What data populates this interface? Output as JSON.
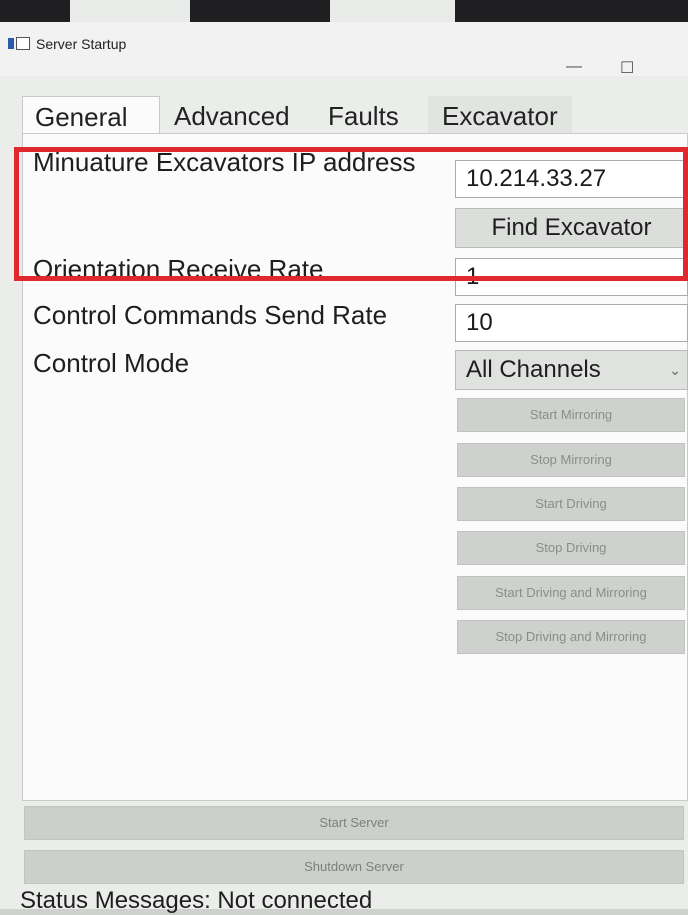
{
  "window": {
    "title": "Server Startup",
    "controls": [
      "—",
      "☐"
    ]
  },
  "tabs": [
    {
      "label": "General",
      "active": true
    },
    {
      "label": "Advanced",
      "active": false
    },
    {
      "label": "Faults",
      "active": false
    },
    {
      "label": "Excavator",
      "active": false
    }
  ],
  "general": {
    "ip_label": "Minuature Excavators IP address",
    "ip_value": "10.214.33.27",
    "find_button": "Find Excavator",
    "orientation_label": "Orientation Receive Rate",
    "orientation_value": "1",
    "control_rate_label": "Control Commands Send Rate",
    "control_rate_value": "10",
    "control_mode_label": "Control Mode",
    "control_mode_value": "All Channels"
  },
  "actions": [
    "Start Mirroring",
    "Stop Mirroring",
    "Start Driving",
    "Stop Driving",
    "Start Driving and Mirroring",
    "Stop Driving and Mirroring"
  ],
  "footer": {
    "start_server": "Start Server",
    "shutdown_server": "Shutdown Server",
    "status_text": "Status Messages: Not connected"
  },
  "colors": {
    "highlight": "#e0282e"
  }
}
